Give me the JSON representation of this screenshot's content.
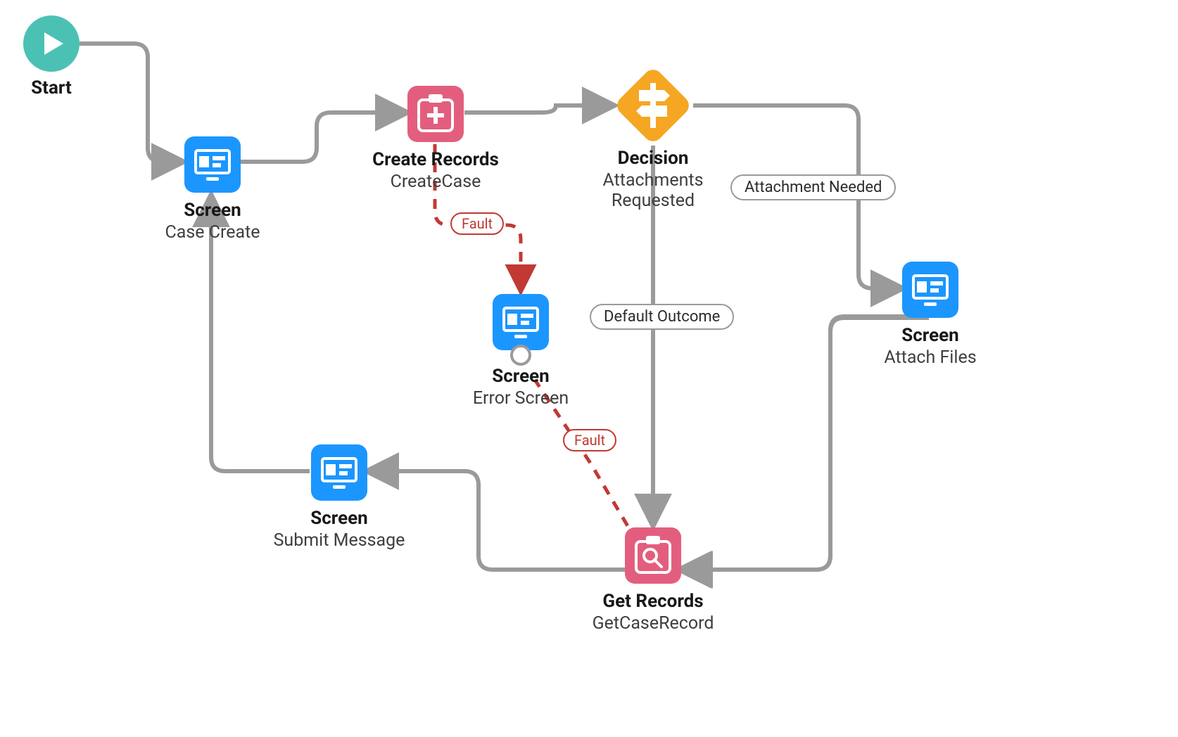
{
  "nodes": {
    "start": {
      "title": "Start",
      "sub": ""
    },
    "screen_case": {
      "title": "Screen",
      "sub": "Case Create"
    },
    "create_records": {
      "title": "Create Records",
      "sub": "CreateCase"
    },
    "decision": {
      "title": "Decision",
      "sub": "Attachments Requested"
    },
    "screen_error": {
      "title": "Screen",
      "sub": "Error Screen"
    },
    "screen_attach": {
      "title": "Screen",
      "sub": "Attach Files"
    },
    "get_records": {
      "title": "Get Records",
      "sub": "GetCaseRecord"
    },
    "screen_submit": {
      "title": "Screen",
      "sub": "Submit Message"
    }
  },
  "edge_labels": {
    "attachment_needed": "Attachment Needed",
    "default_outcome": "Default Outcome",
    "fault": "Fault"
  },
  "colors": {
    "start": "#4bc1b4",
    "screen": "#1b96ff",
    "record": "#e35e7e",
    "decision": "#f5a623",
    "connector": "#9a9a9a",
    "fault": "#c23934"
  },
  "chart_data": {
    "type": "flowchart",
    "nodes": [
      {
        "id": "start",
        "kind": "start",
        "label": "Start"
      },
      {
        "id": "screen_case",
        "kind": "screen",
        "label": "Screen — Case Create"
      },
      {
        "id": "create_records",
        "kind": "create-records",
        "label": "Create Records — CreateCase"
      },
      {
        "id": "decision",
        "kind": "decision",
        "label": "Decision — Attachments Requested"
      },
      {
        "id": "screen_attach",
        "kind": "screen",
        "label": "Screen — Attach Files"
      },
      {
        "id": "get_records",
        "kind": "get-records",
        "label": "Get Records — GetCaseRecord"
      },
      {
        "id": "screen_submit",
        "kind": "screen",
        "label": "Screen — Submit Message"
      },
      {
        "id": "screen_error",
        "kind": "screen",
        "label": "Screen — Error Screen"
      }
    ],
    "edges": [
      {
        "from": "start",
        "to": "screen_case"
      },
      {
        "from": "screen_case",
        "to": "create_records"
      },
      {
        "from": "create_records",
        "to": "decision"
      },
      {
        "from": "create_records",
        "to": "screen_error",
        "kind": "fault",
        "label": "Fault"
      },
      {
        "from": "decision",
        "to": "screen_attach",
        "label": "Attachment Needed"
      },
      {
        "from": "decision",
        "to": "get_records",
        "label": "Default Outcome"
      },
      {
        "from": "screen_attach",
        "to": "get_records"
      },
      {
        "from": "get_records",
        "to": "screen_error",
        "kind": "fault",
        "label": "Fault"
      },
      {
        "from": "get_records",
        "to": "screen_submit"
      },
      {
        "from": "screen_submit",
        "to": "screen_case"
      }
    ]
  }
}
